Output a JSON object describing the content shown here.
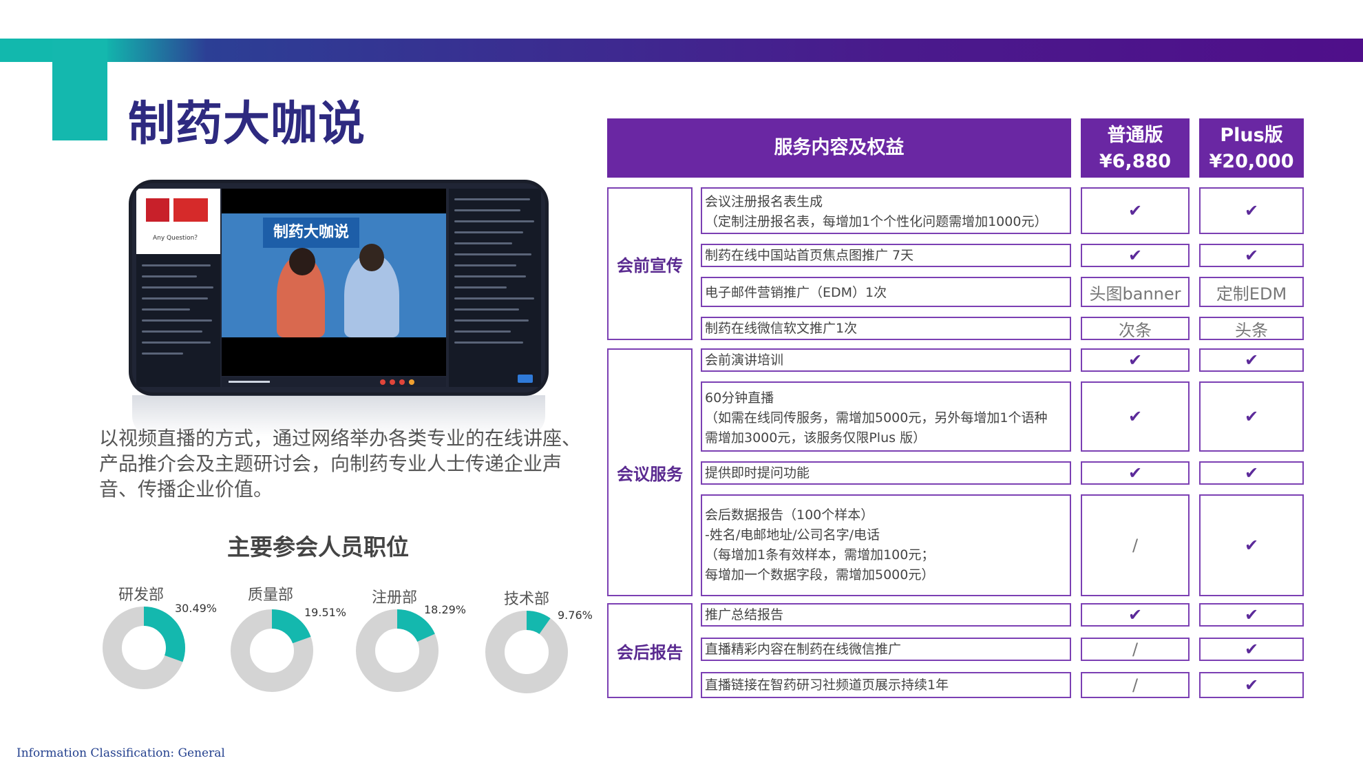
{
  "title": "制药大咖说",
  "video": {
    "logo_caption": "Any Question？",
    "brand_text": "制药大咖说"
  },
  "description": "以视频直播的方式，通过网络举办各类专业的在线讲座、产品推介会及主题研讨会，向制药专业人士传递企业声音、传播企业价值。",
  "participants": {
    "title": "主要参会人员职位",
    "colors": {
      "accent": "#14b8ae",
      "rest": "#d4d4d4"
    },
    "items": [
      {
        "label": "研发部",
        "pct_text": "30.49%",
        "value": 30.49
      },
      {
        "label": "质量部",
        "pct_text": "19.51%",
        "value": 19.51
      },
      {
        "label": "注册部",
        "pct_text": "18.29%",
        "value": 18.29
      },
      {
        "label": "技术部",
        "pct_text": "9.76%",
        "value": 9.76
      }
    ]
  },
  "table": {
    "header": {
      "service": "服务内容及权益",
      "standard_name": "普通版",
      "standard_price": "¥6,880",
      "plus_name": "Plus版",
      "plus_price": "¥20,000"
    },
    "sections": {
      "pre": "会前宣传",
      "meeting": "会议服务",
      "post": "会后报告"
    },
    "rows": [
      {
        "lines": [
          "会议注册报名表生成",
          "（定制注册报名表，每增加1个个性化问题需增加1000元）"
        ],
        "standard": "✔",
        "plus": "✔"
      },
      {
        "lines": [
          "制药在线中国站首页焦点图推广 7天"
        ],
        "standard": "✔",
        "plus": "✔"
      },
      {
        "lines": [
          "电子邮件营销推广（EDM）1次"
        ],
        "standard": "头图banner",
        "plus": "定制EDM"
      },
      {
        "lines": [
          "制药在线微信软文推广1次"
        ],
        "standard": "次条",
        "plus": "头条"
      },
      {
        "lines": [
          "会前演讲培训"
        ],
        "standard": "✔",
        "plus": "✔"
      },
      {
        "lines": [
          "60分钟直播",
          "（如需在线同传服务，需增加5000元，另外每增加1个语种",
          "需增加3000元，该服务仅限Plus 版）"
        ],
        "standard": "✔",
        "plus": "✔"
      },
      {
        "lines": [
          "提供即时提问功能"
        ],
        "standard": "✔",
        "plus": "✔"
      },
      {
        "lines": [
          "会后数据报告（100个样本）",
          "-姓名/电邮地址/公司名字/电话",
          "（每增加1条有效样本，需增加100元；",
          "每增加一个数据字段，需增加5000元）"
        ],
        "standard": "/",
        "plus": "✔"
      },
      {
        "lines": [
          "推广总结报告"
        ],
        "standard": "✔",
        "plus": "✔"
      },
      {
        "lines": [
          "直播精彩内容在制药在线微信推广"
        ],
        "standard": "/",
        "plus": "✔"
      },
      {
        "lines": [
          "直播链接在智药研习社频道页展示持续1年"
        ],
        "standard": "/",
        "plus": "✔"
      }
    ]
  },
  "footer": "Information Classification: General"
}
